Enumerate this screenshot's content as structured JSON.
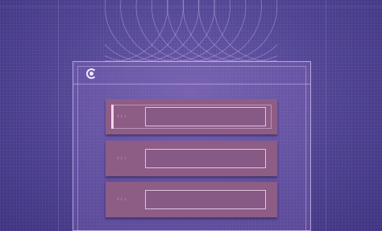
{
  "app": {
    "logo_icon": "swirl-logo-icon"
  },
  "form": {
    "fields": [
      {
        "label": "l i i",
        "value": "",
        "focused": true
      },
      {
        "label": "l i i",
        "value": "",
        "focused": false
      },
      {
        "label": "l i i",
        "value": "",
        "focused": false
      }
    ]
  },
  "colors": {
    "background": "#4b3f8c",
    "panel_border": "#d7bef0",
    "row_fill": "#8d5d86",
    "field_border": "#f0d7f0",
    "focus_accent": "#f3d2ec"
  }
}
